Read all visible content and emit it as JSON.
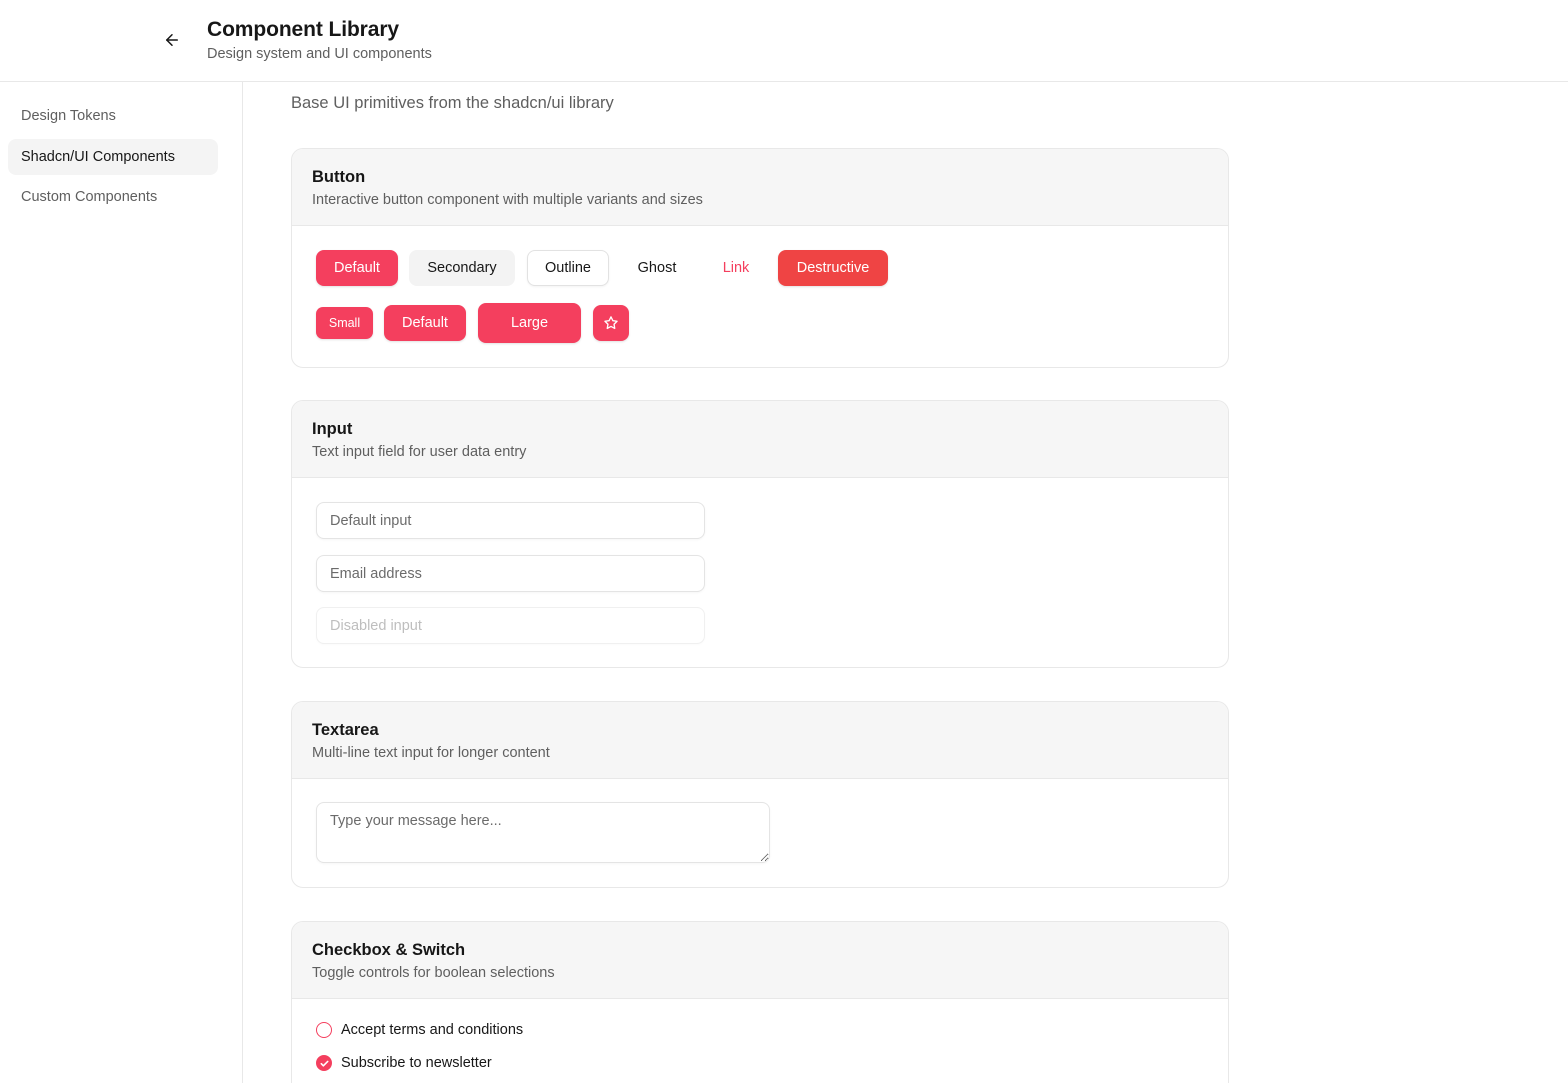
{
  "header": {
    "title": "Component Library",
    "subtitle": "Design system and UI components"
  },
  "sidebar": {
    "items": [
      {
        "label": "Design Tokens"
      },
      {
        "label": "Shadcn/UI Components"
      },
      {
        "label": "Custom Components"
      }
    ],
    "active_item": "Shadcn/UI Components"
  },
  "main": {
    "intro": "Base UI primitives from the shadcn/ui library",
    "button_card": {
      "title": "Button",
      "description": "Interactive button component with multiple variants and sizes",
      "variants": [
        "Default",
        "Secondary",
        "Outline",
        "Ghost",
        "Link",
        "Destructive"
      ],
      "sizes": [
        "Small",
        "Default",
        "Large"
      ],
      "icon_button_icon": "star-icon"
    },
    "input_card": {
      "title": "Input",
      "description": "Text input field for user data entry",
      "default_placeholder": "Default input",
      "email_placeholder": "Email address",
      "disabled_placeholder": "Disabled input"
    },
    "textarea_card": {
      "title": "Textarea",
      "description": "Multi-line text input for longer content",
      "placeholder": "Type your message here..."
    },
    "checkbox_card": {
      "title": "Checkbox & Switch",
      "description": "Toggle controls for boolean selections",
      "options": [
        {
          "label": "Accept terms and conditions",
          "checked": false
        },
        {
          "label": "Subscribe to newsletter",
          "checked": true
        }
      ]
    }
  },
  "colors": {
    "primary": "#f43f5e",
    "destructive": "#ef4444",
    "muted_text": "#5f5f5f",
    "border": "#e8e8e8"
  }
}
